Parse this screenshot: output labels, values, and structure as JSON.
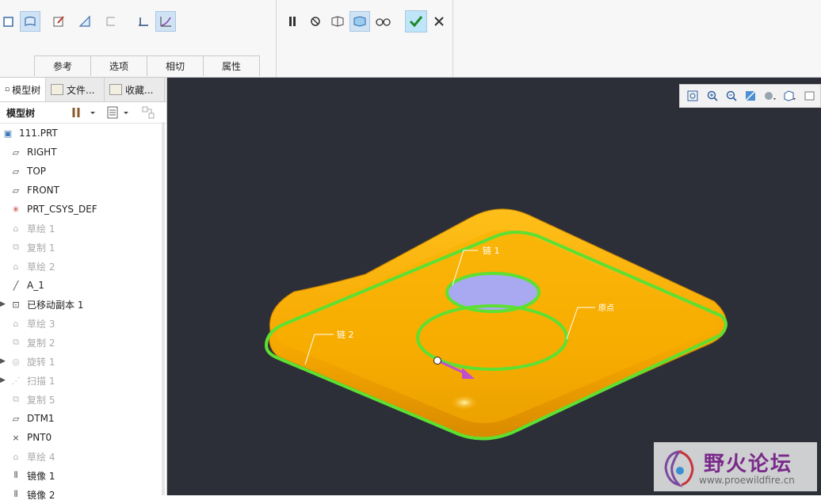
{
  "ribbon": {
    "subtabs": [
      "参考",
      "选项",
      "相切",
      "属性"
    ],
    "left_tools": [
      "solid-icon",
      "surface-icon",
      "edit-sketch-icon",
      "thicken-icon",
      "blank-icon",
      "section-icon",
      "curve-icon"
    ],
    "right_tools": [
      "pause-icon",
      "no-preview-icon",
      "preview-icon",
      "attached-preview-icon",
      "verify-icon",
      "ok-icon",
      "cancel-icon"
    ]
  },
  "panel": {
    "tabs": [
      {
        "label": "模型树"
      },
      {
        "label": "文件..."
      },
      {
        "label": "收藏..."
      }
    ],
    "tree_header": "模型树",
    "items": [
      {
        "label": "111.PRT",
        "icon": "part-icon",
        "dim": false,
        "expand": ""
      },
      {
        "label": "RIGHT",
        "icon": "datum-plane-icon",
        "dim": false,
        "expand": ""
      },
      {
        "label": "TOP",
        "icon": "datum-plane-icon",
        "dim": false,
        "expand": ""
      },
      {
        "label": "FRONT",
        "icon": "datum-plane-icon",
        "dim": false,
        "expand": ""
      },
      {
        "label": "PRT_CSYS_DEF",
        "icon": "csys-icon",
        "dim": false,
        "expand": ""
      },
      {
        "label": "草绘 1",
        "icon": "sketch-icon",
        "dim": true,
        "expand": ""
      },
      {
        "label": "复制 1",
        "icon": "copy-icon",
        "dim": true,
        "expand": ""
      },
      {
        "label": "草绘 2",
        "icon": "sketch-icon",
        "dim": true,
        "expand": ""
      },
      {
        "label": "A_1",
        "icon": "axis-icon",
        "dim": false,
        "expand": ""
      },
      {
        "label": "已移动副本 1",
        "icon": "moved-copy-icon",
        "dim": false,
        "expand": "▶"
      },
      {
        "label": "草绘 3",
        "icon": "sketch-icon",
        "dim": true,
        "expand": ""
      },
      {
        "label": "复制 2",
        "icon": "copy-icon",
        "dim": true,
        "expand": ""
      },
      {
        "label": "旋转 1",
        "icon": "revolve-icon",
        "dim": true,
        "expand": "▶"
      },
      {
        "label": "扫描 1",
        "icon": "sweep-icon",
        "dim": true,
        "expand": "▶"
      },
      {
        "label": "复制 5",
        "icon": "copy-icon",
        "dim": true,
        "expand": ""
      },
      {
        "label": "DTM1",
        "icon": "datum-plane-icon",
        "dim": false,
        "expand": ""
      },
      {
        "label": "PNT0",
        "icon": "datum-point-icon",
        "dim": false,
        "expand": ""
      },
      {
        "label": "草绘 4",
        "icon": "sketch-icon",
        "dim": true,
        "expand": ""
      },
      {
        "label": "镜像 1",
        "icon": "mirror-icon",
        "dim": false,
        "expand": ""
      },
      {
        "label": "镜像 2",
        "icon": "mirror-icon",
        "dim": false,
        "expand": ""
      }
    ]
  },
  "viewport": {
    "labels": {
      "chain1": "链 1",
      "chain2": "链 2",
      "origin": "原点"
    },
    "colors": {
      "background": "#2d2f38",
      "body": "#f5a800",
      "edge": "#5ee032",
      "hole": "#a9a9f2",
      "arrow": "#c04fd0"
    }
  },
  "watermark": {
    "title": "野火论坛",
    "url": "www.proewildfire.cn"
  }
}
